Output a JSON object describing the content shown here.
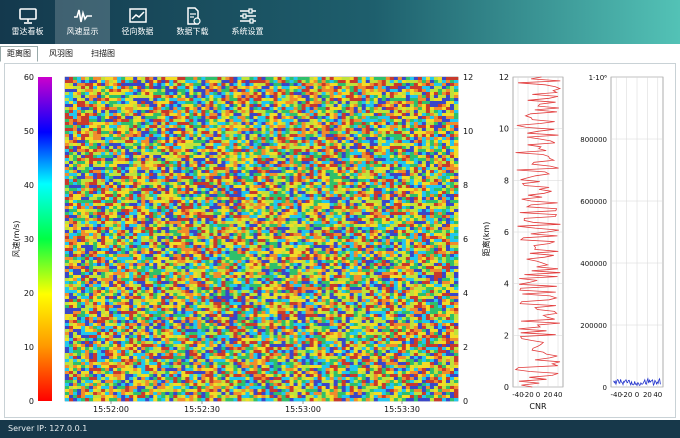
{
  "toolbar": {
    "items": [
      {
        "label": "雷达看板",
        "icon": "monitor-icon",
        "active": false
      },
      {
        "label": "风速显示",
        "icon": "wind-wave-icon",
        "active": true
      },
      {
        "label": "径向数据",
        "icon": "line-chart-icon",
        "active": false
      },
      {
        "label": "数据下载",
        "icon": "file-download-icon",
        "active": false
      },
      {
        "label": "系统设置",
        "icon": "sliders-icon",
        "active": false
      }
    ]
  },
  "tabs": [
    {
      "label": "距离图",
      "active": true
    },
    {
      "label": "风羽图",
      "active": false
    },
    {
      "label": "扫描图",
      "active": false
    }
  ],
  "status": {
    "text": "Server IP: 127.0.0.1"
  },
  "chart_data": [
    {
      "type": "heatmap",
      "x_ticks": [
        "15:52:00",
        "15:52:30",
        "15:53:00",
        "15:53:30"
      ],
      "y_right_ticks": [
        0,
        2,
        4,
        6,
        8,
        10,
        12
      ],
      "colorbar": {
        "label": "风速(m/s)",
        "ticks": [
          0,
          10,
          20,
          30,
          40,
          50,
          60
        ],
        "range": [
          0,
          60
        ]
      },
      "colors": [
        "#3a47c8",
        "#21c6ee",
        "#2fbf6a",
        "#bfe23a",
        "#f1dc26",
        "#f08c2c",
        "#c83a2c"
      ]
    },
    {
      "type": "line",
      "ylabel": "距离(km)",
      "xlabel": "CNR",
      "x_ticks": [
        "-40",
        "-20",
        "0",
        "20",
        "40"
      ],
      "y_ticks": [
        0,
        2,
        4,
        6,
        8,
        10,
        12
      ],
      "xlim": [
        -50,
        50
      ],
      "ylim": [
        0,
        12
      ],
      "color": "#e23b3b"
    },
    {
      "type": "line",
      "x_ticks": [
        "-40",
        "-20",
        "0",
        "20",
        "40"
      ],
      "y_ticks": [
        "0",
        "200000",
        "400000",
        "600000",
        "800000",
        "1·10⁶"
      ],
      "xlim": [
        -50,
        50
      ],
      "ylim": [
        0,
        1000000
      ],
      "color": "#2233cc"
    }
  ]
}
